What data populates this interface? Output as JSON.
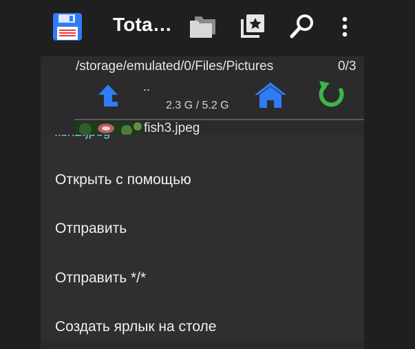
{
  "app": {
    "title": "Tota…",
    "icons": [
      "floppy-disk-icon",
      "folder-icon",
      "favorites-icon",
      "search-icon",
      "more-vert-icon"
    ]
  },
  "panel": {
    "path": "/storage/emulated/0/Files/Pictures",
    "count": "0/3",
    "parent_dir": "..",
    "storage": "2.3 G / 5.2 G",
    "file_name": "fish3.jpeg",
    "colors": {
      "up_arrow": "#2f7cf6",
      "home": "#2f7cf6",
      "refresh": "#3db54a"
    }
  },
  "menu": {
    "header": "fish2.jpeg",
    "items": [
      {
        "label": "Открыть с помощью"
      },
      {
        "label": "Отправить"
      },
      {
        "label": "Отправить */*"
      },
      {
        "label": "Создать ярлык на столе"
      }
    ]
  }
}
